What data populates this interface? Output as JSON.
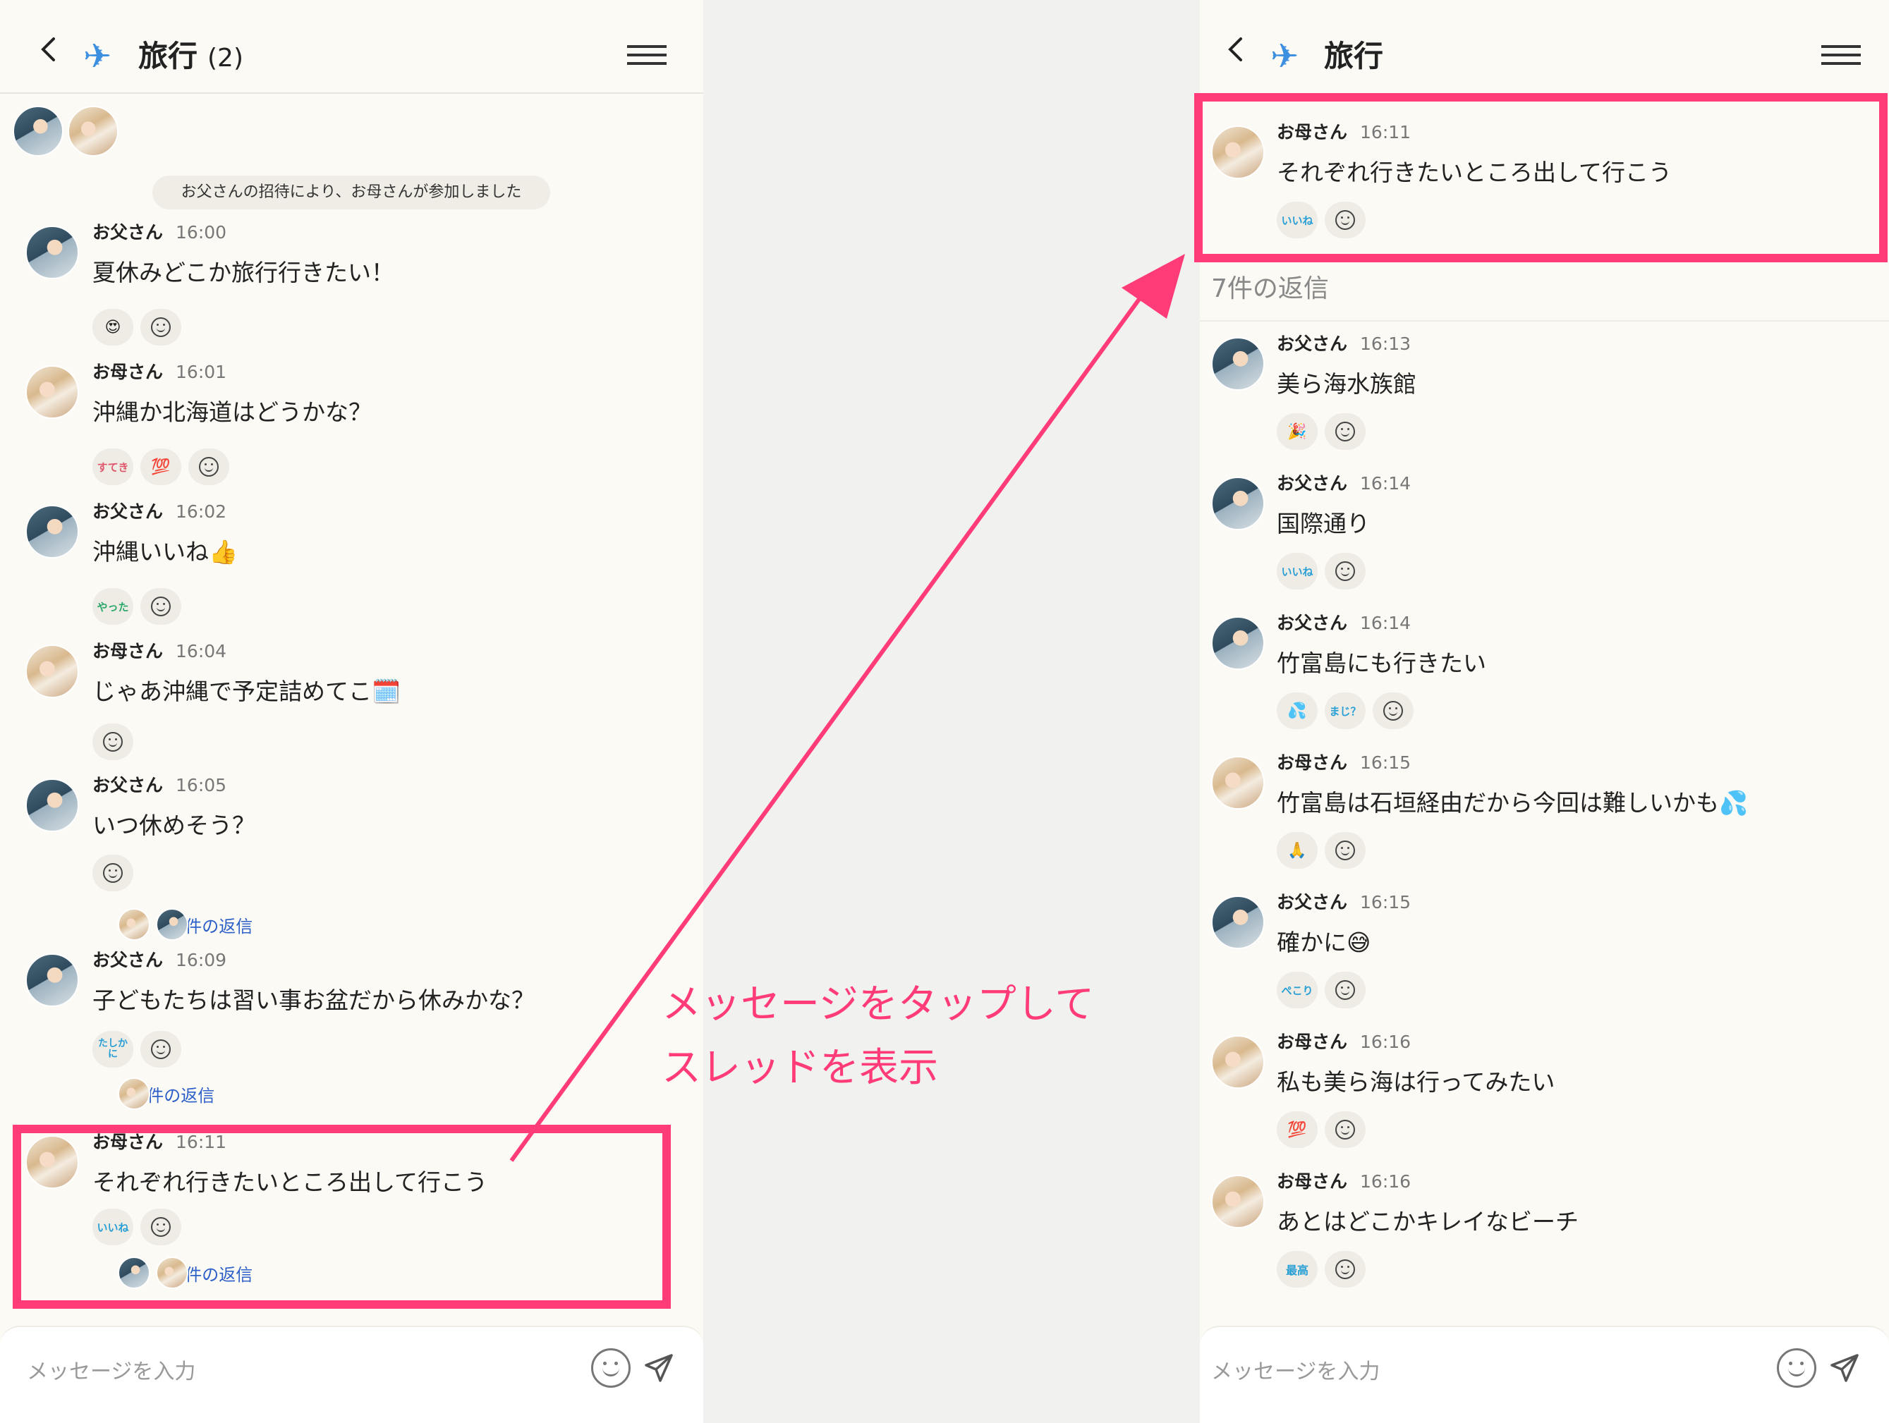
{
  "left": {
    "header": {
      "title": "旅行",
      "count": "(2)"
    },
    "system_message": "お父さんの招待により、お母さんが参加しました",
    "messages": [
      {
        "sender": "お父さん",
        "time": "16:00",
        "text": "夏休みどこか旅行行きたい！",
        "reactions": [
          "😍"
        ]
      },
      {
        "sender": "お母さん",
        "time": "16:01",
        "text": "沖縄か北海道はどうかな？",
        "reactions": [
          "すてき",
          "💯"
        ]
      },
      {
        "sender": "お父さん",
        "time": "16:02",
        "text": "沖縄いいね👍",
        "reactions": [
          "やった"
        ]
      },
      {
        "sender": "お母さん",
        "time": "16:04",
        "text": "じゃあ沖縄で予定詰めてこ🗓️",
        "reactions": []
      },
      {
        "sender": "お父さん",
        "time": "16:05",
        "text": "いつ休めそう？",
        "reactions": [],
        "replies": "3件の返信"
      },
      {
        "sender": "お父さん",
        "time": "16:09",
        "text": "子どもたちは習い事お盆だから休みかな？",
        "reactions": [
          "たしかに"
        ],
        "replies": "1件の返信"
      },
      {
        "sender": "お母さん",
        "time": "16:11",
        "text": "それぞれ行きたいところ出して行こう",
        "reactions": [
          "いいね"
        ],
        "replies": "7件の返信"
      }
    ],
    "input_placeholder": "メッセージを入力"
  },
  "right": {
    "header": {
      "title": "旅行"
    },
    "parent": {
      "sender": "お母さん",
      "time": "16:11",
      "text": "それぞれ行きたいところ出して行こう",
      "reactions": [
        "いいね"
      ]
    },
    "reply_count": "7件の返信",
    "replies": [
      {
        "sender": "お父さん",
        "time": "16:13",
        "text": "美ら海水族館",
        "reactions": [
          "🎉"
        ]
      },
      {
        "sender": "お父さん",
        "time": "16:14",
        "text": "国際通り",
        "reactions": [
          "いいね"
        ]
      },
      {
        "sender": "お父さん",
        "time": "16:14",
        "text": "竹富島にも行きたい",
        "reactions": [
          "💦",
          "まじ？"
        ]
      },
      {
        "sender": "お母さん",
        "time": "16:15",
        "text": "竹富島は石垣経由だから今回は難しいかも💦",
        "reactions": [
          "🙏"
        ]
      },
      {
        "sender": "お父さん",
        "time": "16:15",
        "text": "確かに😅",
        "reactions": [
          "ぺこり"
        ]
      },
      {
        "sender": "お母さん",
        "time": "16:16",
        "text": "私も美ら海は行ってみたい",
        "reactions": [
          "💯"
        ]
      },
      {
        "sender": "お母さん",
        "time": "16:16",
        "text": "あとはどこかキレイなビーチ",
        "reactions": [
          "最高"
        ]
      }
    ],
    "input_placeholder": "メッセージを入力"
  },
  "annotation": {
    "line1": "メッセージをタップして",
    "line2": "スレッドを表示"
  },
  "colors": {
    "accent": "#ff3b78",
    "link": "#2d5fc8",
    "background": "#fbfaf5"
  },
  "icons": [
    "back-chevron-icon",
    "airplane-icon",
    "hamburger-menu-icon",
    "emoji-smile-icon",
    "send-paper-plane-icon",
    "add-reaction-icon"
  ]
}
